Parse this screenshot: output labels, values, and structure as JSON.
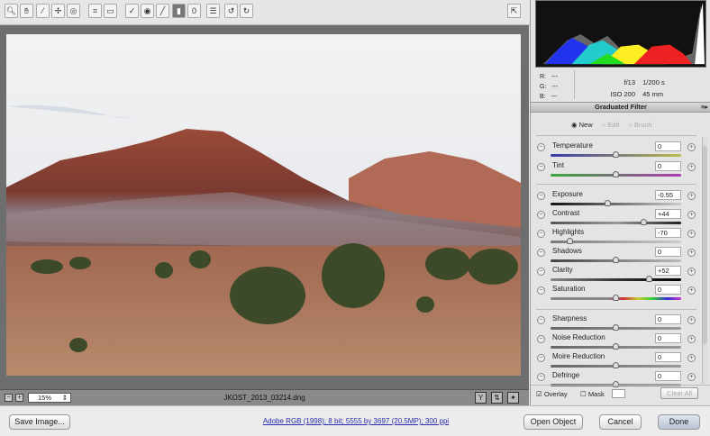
{
  "toolbar": {
    "tools": [
      "zoom-icon",
      "hand-icon",
      "white-balance-icon",
      "color-sampler-icon",
      "targeted-adjustment-icon",
      "crop-icon",
      "straighten-icon",
      "spot-removal-icon",
      "red-eye-icon",
      "adjustment-brush-icon",
      "graduated-filter-icon",
      "radial-filter-icon",
      "preferences-icon",
      "rotate-left-icon",
      "rotate-right-icon"
    ],
    "active": "graduated-filter-icon"
  },
  "status": {
    "zoom": "15%",
    "filename": "JKOST_2013_03214.dng"
  },
  "info": {
    "r": "R:",
    "g": "G:",
    "b": "B:",
    "rv": "---",
    "gv": "---",
    "bv": "---",
    "aperture": "f/13",
    "shutter": "1/200 s",
    "iso": "ISO 200",
    "focal": "45 mm"
  },
  "panel": {
    "title": "Graduated Filter",
    "modes": [
      "New",
      "Edit",
      "Brush"
    ],
    "selected_mode": "New",
    "sliders": [
      {
        "label": "Temperature",
        "value": "0",
        "pos": 0.5,
        "track": "linear-gradient(90deg,#3a3aa8,#bcbc50)"
      },
      {
        "label": "Tint",
        "value": "0",
        "pos": 0.5,
        "track": "linear-gradient(90deg,#3aa83a,#b03ab0)"
      },
      {
        "label": "Exposure",
        "value": "-0.55",
        "pos": 0.44,
        "track": "linear-gradient(90deg,#111,#ccc)"
      },
      {
        "label": "Contrast",
        "value": "+44",
        "pos": 0.72,
        "track": "linear-gradient(90deg,#555,#999,#222)"
      },
      {
        "label": "Highlights",
        "value": "-70",
        "pos": 0.15,
        "track": "linear-gradient(90deg,#777,#ccc)"
      },
      {
        "label": "Shadows",
        "value": "0",
        "pos": 0.5,
        "track": "linear-gradient(90deg,#444,#bbb)"
      },
      {
        "label": "Clarity",
        "value": "+52",
        "pos": 0.76,
        "track": "linear-gradient(90deg,#888,#333,#000)"
      },
      {
        "label": "Saturation",
        "value": "0",
        "pos": 0.5,
        "track": "linear-gradient(90deg,#888,#888 45%,#c33,#cc3,#3c3,#33c,#c3c)"
      },
      {
        "label": "Sharpness",
        "value": "0",
        "pos": 0.5,
        "track": "linear-gradient(90deg,#666,#999)"
      },
      {
        "label": "Noise Reduction",
        "value": "0",
        "pos": 0.5,
        "track": "linear-gradient(90deg,#666,#999)"
      },
      {
        "label": "Moire Reduction",
        "value": "0",
        "pos": 0.5,
        "track": "linear-gradient(90deg,#666,#999)"
      },
      {
        "label": "Defringe",
        "value": "0",
        "pos": 0.5,
        "track": "linear-gradient(90deg,#666,#999)"
      }
    ],
    "overlay": "Overlay",
    "overlay_checked": true,
    "mask": "Mask",
    "mask_checked": false,
    "clear_all": "Clear All"
  },
  "bottom": {
    "save": "Save Image...",
    "workflow_link": "Adobe RGB (1998); 8 bit; 5555 by 3697 (20.5MP); 300 ppi",
    "open": "Open Object",
    "cancel": "Cancel",
    "done": "Done"
  }
}
